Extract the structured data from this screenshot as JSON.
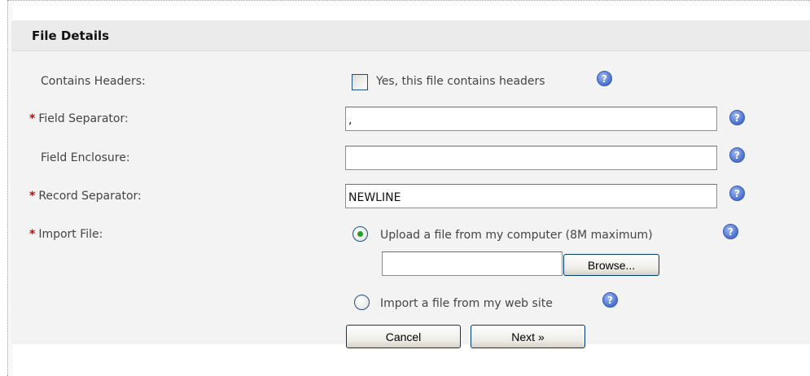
{
  "section": {
    "title": "File Details"
  },
  "fields": {
    "contains_headers": {
      "label": "Contains Headers:",
      "checkbox_label": "Yes, this file contains headers",
      "checked": false
    },
    "field_separator": {
      "required_mark": "*",
      "label": "Field Separator:",
      "value": ","
    },
    "field_enclosure": {
      "label": "Field Enclosure:",
      "value": ""
    },
    "record_separator": {
      "required_mark": "*",
      "label": "Record Separator:",
      "value": "NEWLINE"
    },
    "import_file": {
      "required_mark": "*",
      "label": "Import File:",
      "option_upload": "Upload a file from my computer (8M maximum)",
      "upload_selected": true,
      "file_value": "",
      "browse_label": "Browse...",
      "option_web": "Import a file from my web site"
    }
  },
  "actions": {
    "cancel_label": "Cancel",
    "next_label": "Next »"
  },
  "help_icon_glyph": "?",
  "colors": {
    "required": "#cc0000",
    "help_icon": "#5a7fd8",
    "radio_selected": "#21a121"
  }
}
